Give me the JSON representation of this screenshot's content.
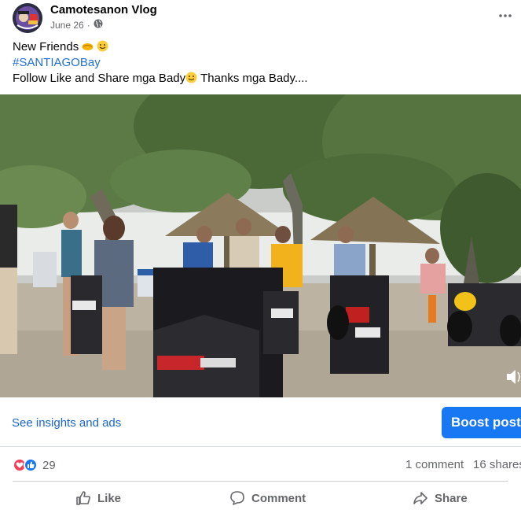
{
  "post": {
    "page_name": "Camotesanon Vlog",
    "date": "June 26",
    "separator": "·",
    "privacy_icon": "globe-icon",
    "more_icon": "more-options-icon",
    "text_line1": "New Friends",
    "text_line1_emojis": [
      "handshake-emoji",
      "smile-emoji"
    ],
    "hashtag": "#SANTIAGOBay",
    "text_line3_a": "Follow Like and Share mga Bady",
    "text_line3_b": "Thanks mga Bady...."
  },
  "media": {
    "description_icon": "beach-scene-with-motorcycles",
    "volume_icon": "volume-icon"
  },
  "insights": {
    "link_label": "See insights and ads",
    "boost_label": "Boost post"
  },
  "stats": {
    "reactions": [
      "love-icon",
      "like-icon"
    ],
    "reaction_count": "29",
    "comments": "1 comment",
    "shares": "16 shares"
  },
  "actions": {
    "like": "Like",
    "comment": "Comment",
    "share": "Share"
  },
  "colors": {
    "accent": "#1877f2",
    "link": "#1b66c9",
    "hashtag": "#216fdb",
    "muted": "#65676b",
    "love": "#f33e58",
    "like": "#1877f2"
  }
}
